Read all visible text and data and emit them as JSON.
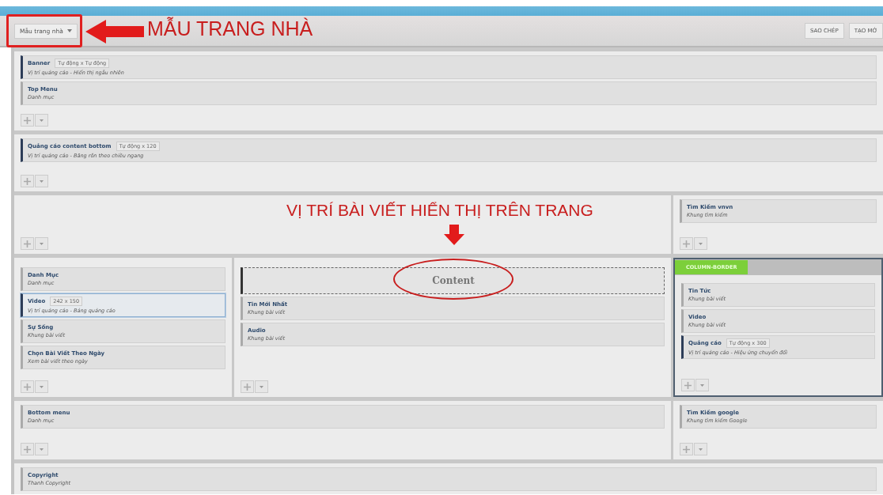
{
  "toolbar": {
    "template_dropdown": {
      "value": "Mẫu trang nhà"
    },
    "buttons": [
      "SAO CHÉP",
      "TẠO MỚ"
    ]
  },
  "rows": [
    {
      "columns": [
        {
          "controls": true,
          "widgets": [
            {
              "kind": "widget",
              "title": "Banner",
              "tag": "Tự động x Tự động",
              "subtitle": "Vị trí quảng cáo - Hiển thị ngẫu nhiên",
              "accent": true,
              "selected": false
            },
            {
              "kind": "widget",
              "title": "Top Menu",
              "subtitle": "Danh mục",
              "accent": false,
              "selected": false
            }
          ]
        }
      ]
    },
    {
      "columns": [
        {
          "controls": true,
          "widgets": [
            {
              "kind": "widget",
              "title": "Quảng cáo content bottom",
              "tag": "Tự động x 120",
              "subtitle": "Vị trí quảng cáo - Băng rôn theo chiều ngang",
              "accent": true,
              "selected": false
            }
          ]
        }
      ]
    },
    {
      "columns": [
        {
          "controls": true
        },
        {
          "controls": true,
          "widgets": [
            {
              "kind": "widget",
              "title": "Tìm Kiếm vnvn",
              "subtitle": "Khung tìm kiếm",
              "accent": false,
              "selected": false
            }
          ]
        }
      ]
    },
    {
      "columns": [
        {
          "controls": true,
          "widgets": [
            {
              "kind": "widget",
              "title": "Danh Mục",
              "subtitle": "Danh mục",
              "accent": false,
              "selected": false
            },
            {
              "kind": "widget",
              "title": "Video",
              "tag": "242 x 150",
              "subtitle": "Vị trí quảng cáo - Bảng quảng cáo",
              "accent": true,
              "selected": true
            },
            {
              "kind": "widget",
              "title": "Sự Sống",
              "subtitle": "Khung bài viết",
              "accent": false,
              "selected": false
            },
            {
              "kind": "widget",
              "title": "Chọn Bài Viết Theo Ngày",
              "subtitle": "Xem bài viết theo ngày",
              "accent": false,
              "selected": false
            }
          ]
        },
        {
          "controls": true,
          "widgets": [
            {
              "kind": "content",
              "title": "Content",
              "accent": true,
              "selected": false
            },
            {
              "kind": "widget",
              "title": "Tin Mới Nhất",
              "subtitle": "Khung bài viết",
              "accent": false,
              "selected": false
            },
            {
              "kind": "widget",
              "title": "Audio",
              "subtitle": "Khung bài viết",
              "accent": false,
              "selected": false
            }
          ]
        },
        {
          "controls": true,
          "label": "COLUMN-BORDER",
          "widgets": [
            {
              "kind": "widget",
              "title": "Tin Tức",
              "subtitle": "Khung bài viết",
              "accent": false,
              "selected": false
            },
            {
              "kind": "widget",
              "title": "Video",
              "subtitle": "Khung bài viết",
              "accent": false,
              "selected": false
            },
            {
              "kind": "widget",
              "title": "Quảng cáo",
              "tag": "Tự động x 300",
              "subtitle": "Vị trí quảng cáo - Hiệu ứng chuyển đổi",
              "accent": true,
              "selected": false
            }
          ]
        }
      ]
    },
    {
      "columns": [
        {
          "controls": true,
          "widgets": [
            {
              "kind": "widget",
              "title": "Bottom menu",
              "subtitle": "Danh mục",
              "accent": false,
              "selected": false
            }
          ]
        },
        {
          "controls": true,
          "widgets": [
            {
              "kind": "widget",
              "title": "Tìm Kiếm google",
              "subtitle": "Khung tìm kiếm Google",
              "accent": false,
              "selected": false
            }
          ]
        }
      ]
    },
    {
      "columns": [
        {
          "controls": false,
          "widgets": [
            {
              "kind": "widget",
              "title": "Copyright",
              "subtitle": "Thanh Copyright",
              "accent": false,
              "selected": false
            }
          ]
        }
      ]
    }
  ],
  "annotations": {
    "template_callout": "MẪU TRANG NHÀ",
    "content_callout": "VỊ TRÍ BÀI VIẾT HIỂN THỊ TRÊN TRANG"
  }
}
